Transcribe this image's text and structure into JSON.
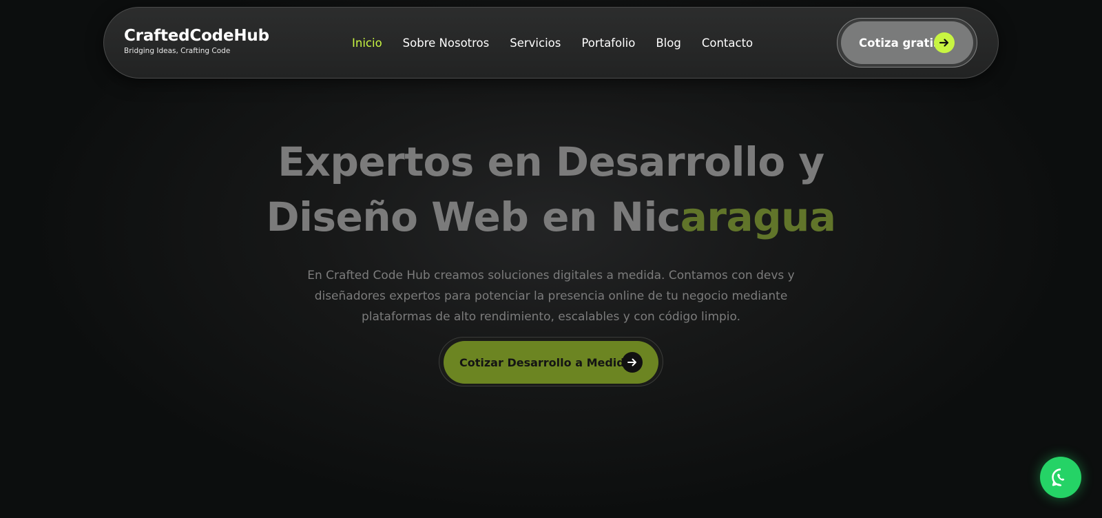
{
  "brand": {
    "name": "CraftedCodeHub",
    "tagline": "Bridging Ideas, Crafting Code"
  },
  "nav": {
    "items": [
      {
        "label": "Inicio",
        "active": true
      },
      {
        "label": "Sobre Nosotros",
        "active": false
      },
      {
        "label": "Servicios",
        "active": false
      },
      {
        "label": "Portafolio",
        "active": false
      },
      {
        "label": "Blog",
        "active": false
      },
      {
        "label": "Contacto",
        "active": false
      }
    ],
    "cta_label": "Cotiza gratis",
    "cta_icon": "arrow-right-icon"
  },
  "hero": {
    "title_line1": "Expertos en Desarrollo y",
    "title_line2_plain": "Diseño Web en Nic",
    "title_line2_accent": "aragua",
    "description": "En Crafted Code Hub creamos soluciones digitales a medida. Contamos con devs y diseñadores expertos para potenciar la presencia online de tu negocio mediante plataformas de alto rendimiento, escalables y con código limpio.",
    "button_label": "Cotizar Desarrollo a Medida",
    "button_icon": "arrow-right-icon"
  },
  "floating": {
    "whatsapp_icon": "whatsapp-icon"
  },
  "colors": {
    "accent": "#c8f542",
    "hero_accent": "#61752a",
    "hero_button": "#6c8522",
    "whatsapp": "#25d366",
    "background": "#0b0d0d"
  }
}
